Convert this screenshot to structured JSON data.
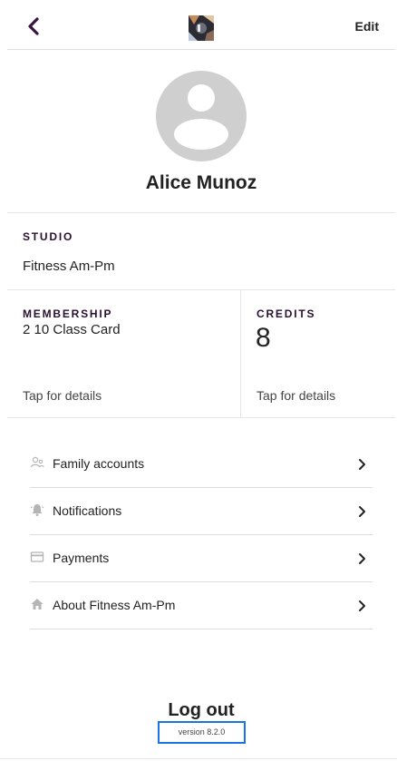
{
  "header": {
    "edit_label": "Edit"
  },
  "profile": {
    "name": "Alice Munoz"
  },
  "studio": {
    "label": "STUDIO",
    "value": "Fitness Am-Pm"
  },
  "membership": {
    "label": "MEMBERSHIP",
    "value": "2 10 Class Card",
    "tap": "Tap for details"
  },
  "credits": {
    "label": "CREDITS",
    "value": "8",
    "tap": "Tap for details"
  },
  "menu": [
    {
      "label": "Family accounts",
      "icon": "family-icon"
    },
    {
      "label": "Notifications",
      "icon": "bell-icon"
    },
    {
      "label": "Payments",
      "icon": "card-icon"
    },
    {
      "label": "About Fitness Am-Pm",
      "icon": "home-icon"
    }
  ],
  "footer": {
    "logout_label": "Log out",
    "version": "version 8.2.0"
  },
  "colors": {
    "accent": "#3a1440",
    "highlight": "#1a73e8"
  }
}
